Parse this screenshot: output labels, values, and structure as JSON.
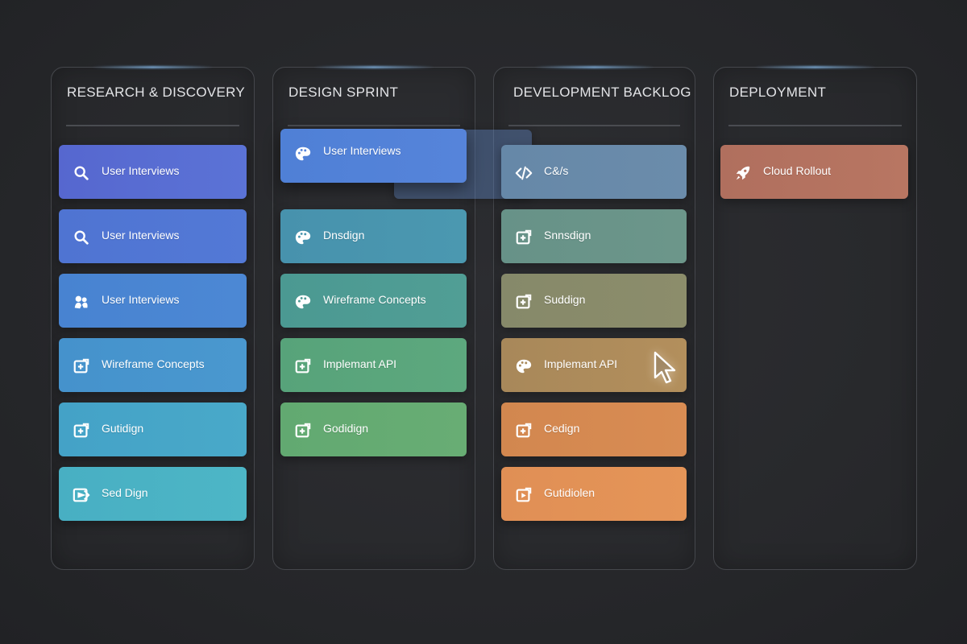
{
  "board": {
    "columns": [
      {
        "title": "RESEARCH & DISCOVERY",
        "cards": [
          {
            "label": "User Interviews",
            "icon": "search-icon"
          },
          {
            "label": "User Interviews",
            "icon": "search-icon"
          },
          {
            "label": "User Interviews",
            "icon": "people-icon"
          },
          {
            "label": "Wireframe Concepts",
            "icon": "add-box-icon"
          },
          {
            "label": "Gutidign",
            "icon": "add-box-icon"
          },
          {
            "label": "Sed Dign",
            "icon": "send-icon"
          }
        ]
      },
      {
        "title": "DESIGN SPRINT",
        "dragging_card": {
          "label": "User Interviews",
          "icon": "palette-icon"
        },
        "cards": [
          {
            "label": "Dnsdign",
            "icon": "palette-icon"
          },
          {
            "label": "Wireframe Concepts",
            "icon": "palette-icon"
          },
          {
            "label": "Implemant API",
            "icon": "add-box-icon"
          },
          {
            "label": "Godidign",
            "icon": "add-box-icon"
          }
        ]
      },
      {
        "title": "DEVELOPMENT BACKLOG",
        "cards": [
          {
            "label": "C&/s",
            "icon": "code-icon"
          },
          {
            "label": "Snnsdign",
            "icon": "add-box-icon"
          },
          {
            "label": "Suddign",
            "icon": "add-box-icon"
          },
          {
            "label": "Implemant API",
            "icon": "palette-icon"
          },
          {
            "label": "Cedign",
            "icon": "add-box-icon"
          },
          {
            "label": "Gutidiolen",
            "icon": "play-box-icon"
          }
        ]
      },
      {
        "title": "DEPLOYMENT",
        "cards": [
          {
            "label": "Cloud Rollout",
            "icon": "rocket-icon"
          }
        ]
      }
    ]
  },
  "colors": {
    "background": "#27282c",
    "column_border": "#45474c",
    "text": "#ffffff",
    "cards": {
      "research": [
        "#5b6cd0",
        "#5078d4",
        "#4a86d2",
        "#4796cd",
        "#47a6c8",
        "#4cb4c4"
      ],
      "design_dragging": "#5680d6",
      "design": [
        "#4a94ae",
        "#4d9a94",
        "#5aa57b",
        "#65ab72"
      ],
      "development": [
        "#6a8aa8",
        "#6a9489",
        "#8a8c6a",
        "#ab8b5b",
        "#d68a52",
        "#e39156"
      ],
      "deployment": [
        "#b4725f"
      ]
    }
  }
}
